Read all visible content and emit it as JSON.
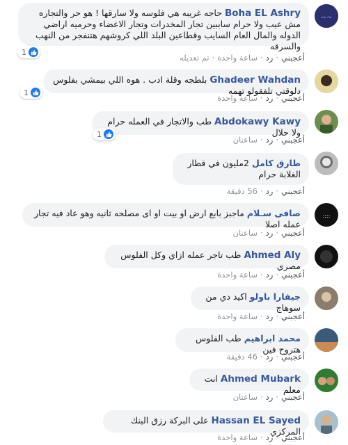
{
  "comments": [
    {
      "name": "Boha EL Ashry",
      "text": "حاجه غريبه هي فلوسه ولا سارقها ! هو حر والتجاره مش عيب ولا حرام ساببين تجار المخدرات وتجار الاعضاء وحرميه اراضي الدوله والمال العام السايب وقطاعين البلد اللي كروشهم هتنفجر من النهب والسرقه",
      "like": "أعجبني",
      "reply": "رد",
      "time": "ساعة واحدة",
      "edited": "تم تعديله",
      "likes_count": "1"
    },
    {
      "name": "Ghadeer Wahdan",
      "text": "بلطجه وقلة ادب . هوه اللي بيمشي بفلوس دلوقتي تلفقولو تهمه",
      "like": "أعجبني",
      "reply": "رد",
      "time": "ساعة واحدة",
      "likes_count": "1"
    },
    {
      "name": "Abdokawy Kawy",
      "text": "طب والاتجار في العمله حرام ولا حلال",
      "like": "أعجبني",
      "reply": "رد",
      "time": "ساعتان",
      "likes_count": "1"
    },
    {
      "name": "طارق كامل",
      "text": "2مليون في قطار الغلابة حرام",
      "like": "أعجبني",
      "reply": "رد",
      "time": "56 دقيقة"
    },
    {
      "name": "صافى سـلام",
      "text": "ماجبز بابع ارض او بيت او اى مصلحه ثانيه وهو عاد فيه تجار عمله اصلا",
      "like": "أعجبني",
      "reply": "رد",
      "time": "ساعتان"
    },
    {
      "name": "Ahmed Aly",
      "text": "طب تاجر عمله ازاي وكل الفلوس مصري",
      "like": "أعجبني",
      "reply": "رد",
      "time": "ساعة واحدة"
    },
    {
      "name": "جيفارا باولو",
      "text": "اكيد دي من سوهاج",
      "like": "أعجبني",
      "reply": "رد",
      "time": "ساعة واحدة"
    },
    {
      "name": "محمد ابراهيم",
      "text": "طب الفلوس هتروح فين",
      "like": "أعجبني",
      "reply": "رد",
      "time": "46 دقيقة"
    },
    {
      "name": "Ahmed Mubark",
      "text": "انت معلم",
      "like": "أعجبني",
      "reply": "رد",
      "time": "ساعتان"
    },
    {
      "name": "Hassan EL Sayed",
      "text": "على البركة رزق البنك المركزي",
      "like": "أعجبني",
      "reply": "رد",
      "time": "ساعة واحدة"
    }
  ]
}
